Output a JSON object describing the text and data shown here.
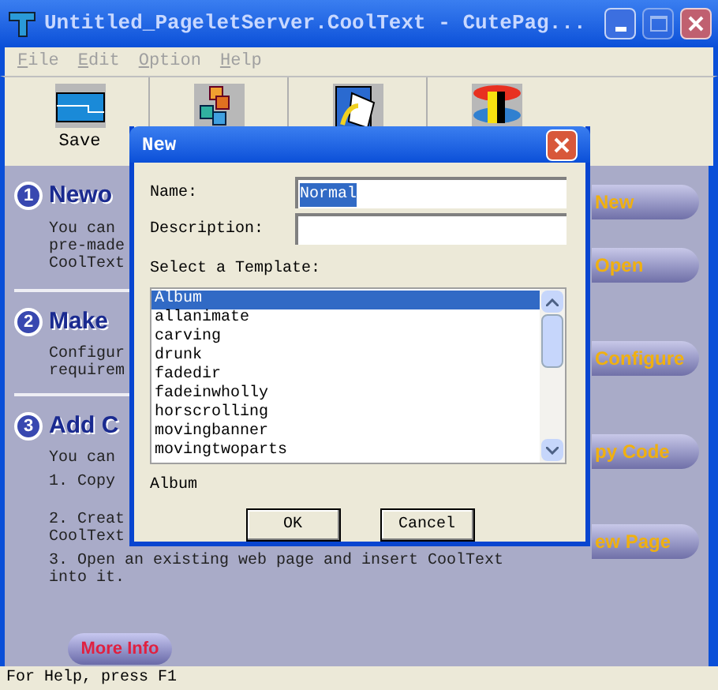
{
  "window": {
    "title": "Untitled_PageletServer.CoolText - CutePag..."
  },
  "menu": [
    "File",
    "Edit",
    "Option",
    "Help"
  ],
  "toolbar": [
    {
      "kind": "save",
      "label": "Save"
    },
    {
      "kind": "tiles"
    },
    {
      "kind": "page"
    },
    {
      "kind": "layers"
    }
  ],
  "steps": [
    {
      "number": "1",
      "heading": "Newo",
      "paragraphs": [
        [
          "You can",
          "pre-made",
          "CoolText"
        ]
      ]
    },
    {
      "number": "2",
      "heading": "Make",
      "paragraphs": [
        [
          "Configur",
          "requirem"
        ]
      ]
    },
    {
      "number": "3",
      "heading": "Add C",
      "paragraphs": [
        [
          "You can"
        ],
        [
          "1. Copy"
        ],
        [
          "2. Creat",
          "CoolText"
        ],
        [
          "3. Open an existing web page and insert CoolText",
          "into it."
        ]
      ]
    }
  ],
  "more_info_button": "More Info",
  "side_buttons": [
    "New",
    "Open",
    "Configure",
    "py Code",
    "ew Page"
  ],
  "status_bar": "For Help, press F1",
  "dialog": {
    "title": "New",
    "name_label": "Name:",
    "name_value": "Normal",
    "description_label": "Description:",
    "template_label": "Select a Template:",
    "templates": [
      {
        "label": "Album",
        "selected": true
      },
      {
        "label": "allanimate",
        "selected": false
      },
      {
        "label": "carving",
        "selected": false
      },
      {
        "label": "drunk",
        "selected": false
      },
      {
        "label": "fadedir",
        "selected": false
      },
      {
        "label": "fadeinwholly",
        "selected": false
      },
      {
        "label": "horscrolling",
        "selected": false
      },
      {
        "label": "movingbanner",
        "selected": false
      },
      {
        "label": "movingtwoparts",
        "selected": false
      }
    ],
    "selected_template": "Album",
    "buttons": [
      "OK",
      "Cancel"
    ]
  }
}
